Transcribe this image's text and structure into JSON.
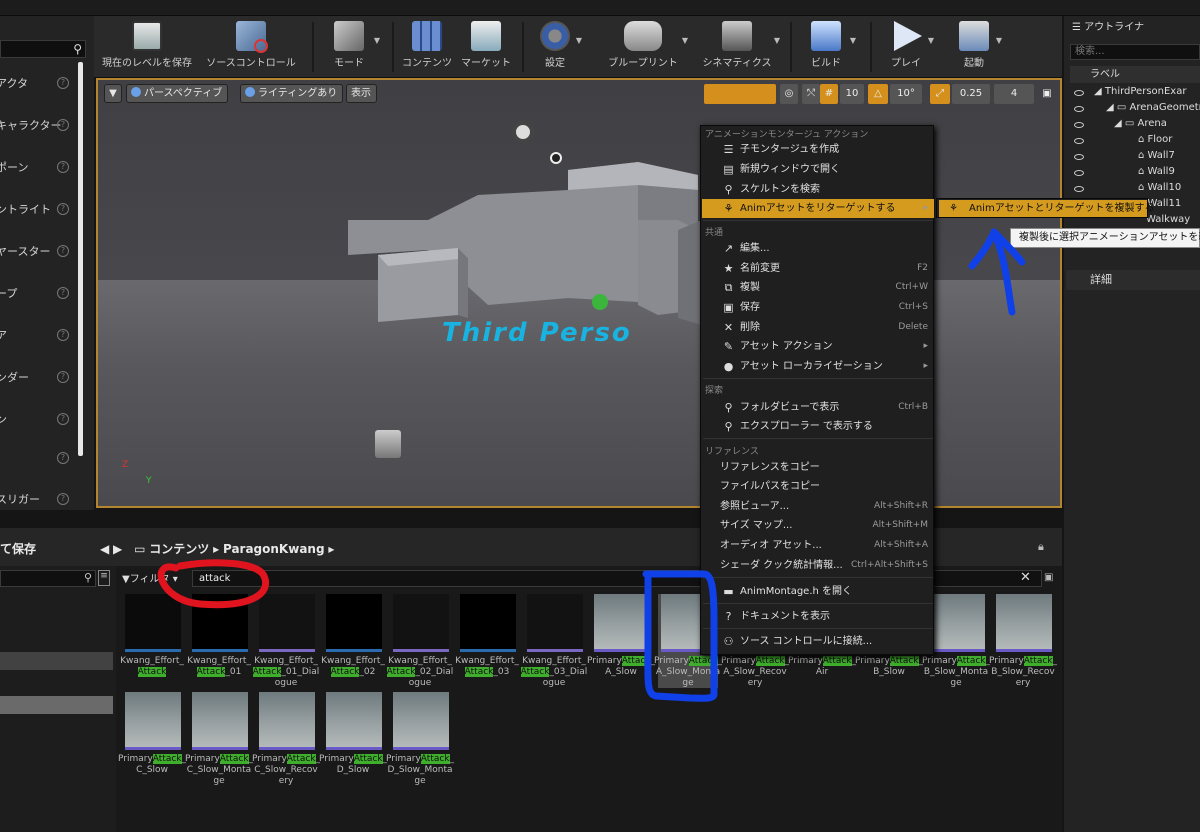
{
  "toolbar": {
    "buttons": [
      {
        "label": "現在のレベルを保存",
        "icon": "save-icon"
      },
      {
        "label": "ソースコントロール",
        "icon": "source-control-icon"
      },
      {
        "label": "モード",
        "icon": "modes-icon"
      },
      {
        "label": "コンテンツ",
        "icon": "content-icon"
      },
      {
        "label": "マーケット",
        "icon": "marketplace-icon"
      },
      {
        "label": "設定",
        "icon": "settings-icon"
      },
      {
        "label": "ブループリント",
        "icon": "blueprint-icon"
      },
      {
        "label": "シネマティクス",
        "icon": "cinematics-icon"
      },
      {
        "label": "ビルド",
        "icon": "build-icon"
      },
      {
        "label": "プレイ",
        "icon": "play-icon"
      },
      {
        "label": "起動",
        "icon": "launch-icon"
      }
    ]
  },
  "left_panel": {
    "items": [
      {
        "label": "アクタ"
      },
      {
        "label": "キャラクター"
      },
      {
        "label": "ポーン"
      },
      {
        "label": "ントライト"
      },
      {
        "label": "ヤースター"
      },
      {
        "label": "ープ"
      },
      {
        "label": "ア"
      },
      {
        "label": "ンダー"
      },
      {
        "label": "ン"
      },
      {
        "label": ""
      },
      {
        "label": "スリガー"
      }
    ]
  },
  "viewport": {
    "perspective": "パースペクティブ",
    "lighting": "ライティングあり",
    "show": "表示",
    "grid_value": "10",
    "angle_value": "10°",
    "scale_value": "0.25",
    "camera_speed": "4",
    "overlay_text": "Third Perso"
  },
  "outliner": {
    "title": "アウトライナ",
    "search_placeholder": "検索...",
    "label_header": "ラベル",
    "rows": [
      {
        "label": "ThirdPersonExar"
      },
      {
        "label": "ArenaGeometr"
      },
      {
        "label": "Arena"
      },
      {
        "label": "Floor"
      },
      {
        "label": "Wall7"
      },
      {
        "label": "Wall9"
      },
      {
        "label": "Wall10"
      },
      {
        "label": "Wall11"
      },
      {
        "label": "Walkway"
      }
    ],
    "tooltip": "複製後に選択アニメーションアセットを新規",
    "details": "詳細"
  },
  "content_browser": {
    "save_label": "て保存",
    "crumb_root": "コンテンツ",
    "crumb_folder": "ParagonKwang",
    "filter_label": "フィルタ",
    "search_value": "attack",
    "tiles_row1": [
      {
        "pre": "Kwang_Effort_",
        "hl": "Attack",
        "post": "",
        "kind": "snd"
      },
      {
        "pre": "Kwang_Effort_",
        "hl": "Attack",
        "post": "_01",
        "kind": "wav"
      },
      {
        "pre": "Kwang_Effort_",
        "hl": "Attack",
        "post": "_01_Dialogue",
        "kind": "dlg"
      },
      {
        "pre": "Kwang_Effort_",
        "hl": "Attack",
        "post": "_02",
        "kind": "wav"
      },
      {
        "pre": "Kwang_Effort_",
        "hl": "Attack",
        "post": "_02_Dialogue",
        "kind": "dlg"
      },
      {
        "pre": "Kwang_Effort_",
        "hl": "Attack",
        "post": "_03",
        "kind": "wav"
      },
      {
        "pre": "Kwang_Effort_",
        "hl": "Attack",
        "post": "_03_Dialogue",
        "kind": "dlg"
      },
      {
        "pre": "Primary",
        "hl": "Attack",
        "post": "_A_Slow",
        "kind": "ani"
      },
      {
        "pre": "Primary",
        "hl": "Attack",
        "post": "_A_Slow_Montage",
        "kind": "ani"
      },
      {
        "pre": "Primary",
        "hl": "Attack",
        "post": "_A_Slow_Recovery",
        "kind": "ani"
      },
      {
        "pre": "Primary",
        "hl": "Attack",
        "post": "_Air",
        "kind": "ani"
      },
      {
        "pre": "Primary",
        "hl": "Attack",
        "post": "_B_Slow",
        "kind": "ani"
      },
      {
        "pre": "Primary",
        "hl": "Attack",
        "post": "_B_Slow_Montage",
        "kind": "ani"
      },
      {
        "pre": "Primary",
        "hl": "Attack",
        "post": "_B_Slow_Recovery",
        "kind": "ani"
      }
    ],
    "tiles_row2": [
      {
        "pre": "Primary",
        "hl": "Attack",
        "post": "_C_Slow",
        "kind": "ani"
      },
      {
        "pre": "Primary",
        "hl": "Attack",
        "post": "_C_Slow_Montage",
        "kind": "ani"
      },
      {
        "pre": "Primary",
        "hl": "Attack",
        "post": "_C_Slow_Recovery",
        "kind": "ani"
      },
      {
        "pre": "Primary",
        "hl": "Attack",
        "post": "_D_Slow",
        "kind": "ani"
      },
      {
        "pre": "Primary",
        "hl": "Attack",
        "post": "_D_Slow_Montage",
        "kind": "ani"
      }
    ]
  },
  "context_menu": {
    "section_anim": "アニメーションモンタージュ アクション",
    "create_child": "子モンタージュを作成",
    "open_new_window": "新規ウィンドウで開く",
    "find_skeleton": "スケルトンを検索",
    "retarget": "Animアセットをリターゲットする",
    "section_common": "共通",
    "edit": "編集...",
    "rename": "名前変更",
    "rename_key": "F2",
    "duplicate": "複製",
    "duplicate_key": "Ctrl+W",
    "save": "保存",
    "save_key": "Ctrl+S",
    "delete": "削除",
    "delete_key": "Delete",
    "asset_actions": "アセット アクション",
    "asset_localization": "アセット ローカライゼーション",
    "section_explore": "探索",
    "show_in_folder": "フォルダビューで表示",
    "show_in_folder_key": "Ctrl+B",
    "show_in_explorer": "エクスプローラー で表示する",
    "section_refs": "リファレンス",
    "copy_refs": "リファレンスをコピー",
    "copy_path": "ファイルパスをコピー",
    "ref_viewer": "参照ビューア...",
    "ref_viewer_key": "Alt+Shift+R",
    "size_map": "サイズ マップ...",
    "size_map_key": "Alt+Shift+M",
    "audit": "オーディオ アセット...",
    "audit_key": "Alt+Shift+A",
    "shader_stats": "シェーダ クック統計情報...",
    "shader_stats_key": "Ctrl+Alt+Shift+S",
    "open_header": "AnimMontage.h を開く",
    "view_docs": "ドキュメントを表示",
    "connect_sc": "ソース コントロールに接続...",
    "submenu_item": "Animアセットとリターゲットを複製する"
  },
  "annotation_colors": {
    "red": "#e0141e",
    "blue": "#1040e8"
  }
}
